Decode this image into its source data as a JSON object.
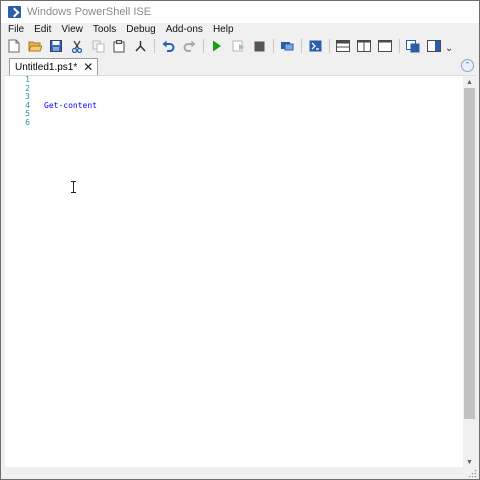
{
  "window": {
    "title": "Windows PowerShell ISE"
  },
  "menu": [
    "File",
    "Edit",
    "View",
    "Tools",
    "Debug",
    "Add-ons",
    "Help"
  ],
  "toolbar": {
    "icons": [
      "new-file-icon",
      "open-folder-icon",
      "save-icon",
      "cut-icon",
      "copy-icon",
      "paste-icon",
      "clear-console-icon",
      "undo-icon",
      "redo-icon",
      "run-script-icon",
      "run-selection-icon",
      "stop-icon",
      "new-remote-tab-icon",
      "start-powershell-icon",
      "show-script-pane-top-icon",
      "show-script-pane-right-icon",
      "show-script-pane-max-icon",
      "show-command-window-icon",
      "show-command-addon-icon"
    ],
    "overflow_glyph": "⌄",
    "colors": {
      "run": "#1a9e1a",
      "undo": "#1f5fbf",
      "stop": "#555555",
      "accent": "#2a5ea8"
    }
  },
  "tabs": [
    {
      "label": "Untitled1.ps1*",
      "close_glyph": "✕",
      "active": true
    }
  ],
  "collapse_glyph": "⌃",
  "editor": {
    "line_numbers": [
      "1",
      "2",
      "3",
      "4",
      "5",
      "6"
    ],
    "lines": [
      "",
      "",
      "",
      "Get-content",
      "",
      ""
    ],
    "cmdlet_color": "#0000ff",
    "line_number_color": "#2b91af"
  },
  "scrollbar": {
    "up_glyph": "▲",
    "down_glyph": "▼"
  }
}
